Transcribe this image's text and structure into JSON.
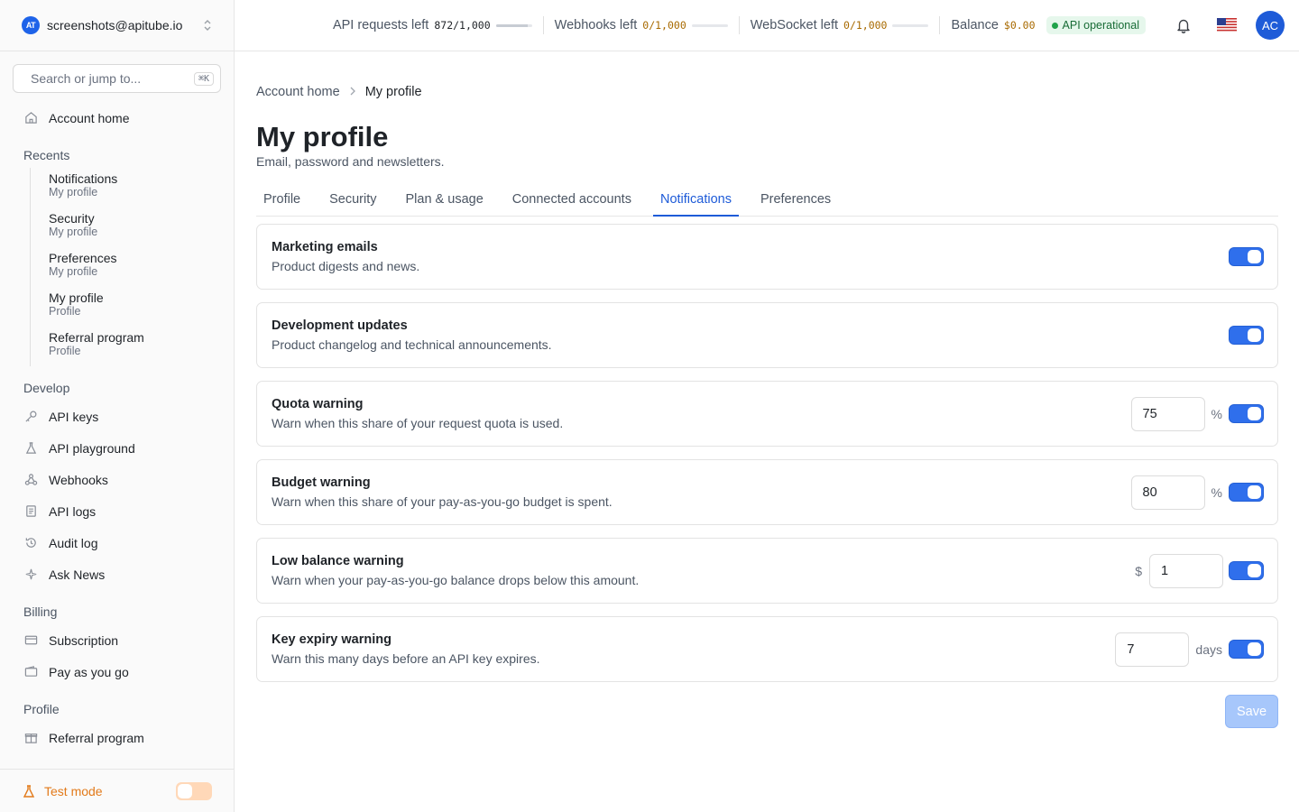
{
  "account": {
    "email": "screenshots@apitube.io",
    "logo_text": "AT"
  },
  "search": {
    "placeholder": "Search or jump to...",
    "shortcut": "⌘K"
  },
  "sidebar": {
    "home": "Account home",
    "recents_label": "Recents",
    "recents": [
      {
        "title": "Notifications",
        "sub": "My profile"
      },
      {
        "title": "Security",
        "sub": "My profile"
      },
      {
        "title": "Preferences",
        "sub": "My profile"
      },
      {
        "title": "My profile",
        "sub": "Profile"
      },
      {
        "title": "Referral program",
        "sub": "Profile"
      }
    ],
    "develop_label": "Develop",
    "develop": [
      "API keys",
      "API playground",
      "Webhooks",
      "API logs",
      "Audit log",
      "Ask News"
    ],
    "billing_label": "Billing",
    "billing": [
      "Subscription",
      "Pay as you go"
    ],
    "profile_label": "Profile",
    "profile": [
      "Referral program"
    ],
    "test_mode": "Test mode"
  },
  "topbar": {
    "api_requests_label": "API requests left",
    "api_requests_value": "872/1,000",
    "api_requests_fraction": 0.872,
    "webhooks_label": "Webhooks left",
    "webhooks_value": "0/1,000",
    "websocket_label": "WebSocket left",
    "websocket_value": "0/1,000",
    "balance_label": "Balance",
    "balance_value": "$0.00",
    "status": "API operational",
    "avatar": "AC"
  },
  "breadcrumb": {
    "home": "Account home",
    "current": "My profile"
  },
  "page": {
    "title": "My profile",
    "subtitle": "Email, password and newsletters."
  },
  "tabs": [
    "Profile",
    "Security",
    "Plan & usage",
    "Connected accounts",
    "Notifications",
    "Preferences"
  ],
  "notifications": {
    "marketing": {
      "title": "Marketing emails",
      "desc": "Product digests and news.",
      "enabled": true
    },
    "development": {
      "title": "Development updates",
      "desc": "Product changelog and technical announcements.",
      "enabled": true
    },
    "quota": {
      "title": "Quota warning",
      "desc": "Warn when this share of your request quota is used.",
      "value": "75",
      "unit": "%",
      "enabled": true
    },
    "budget": {
      "title": "Budget warning",
      "desc": "Warn when this share of your pay-as-you-go budget is spent.",
      "value": "80",
      "unit": "%",
      "enabled": true
    },
    "low_balance": {
      "title": "Low balance warning",
      "desc": "Warn when your pay-as-you-go balance drops below this amount.",
      "prefix": "$",
      "value": "1",
      "enabled": true
    },
    "key_expiry": {
      "title": "Key expiry warning",
      "desc": "Warn this many days before an API key expires.",
      "value": "7",
      "unit": "days",
      "enabled": true
    }
  },
  "save_label": "Save"
}
